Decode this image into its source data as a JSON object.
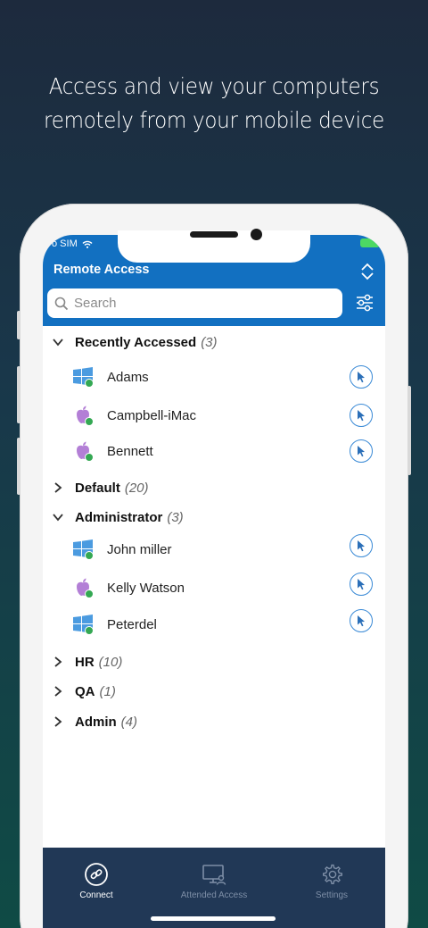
{
  "headline": {
    "line1": "Access and view your computers",
    "line2": "remotely from your mobile device"
  },
  "status_bar": {
    "carrier": "o SIM"
  },
  "app": {
    "title": "Remote Access",
    "search_placeholder": "Search"
  },
  "groups": [
    {
      "name": "Recently Accessed",
      "count": "(3)",
      "expanded": true,
      "computers": [
        {
          "name": "Adams",
          "os": "windows-icon",
          "online": true
        },
        {
          "name": "Campbell-iMac",
          "os": "apple-icon",
          "online": true
        },
        {
          "name": "Bennett",
          "os": "apple-icon",
          "online": true
        }
      ]
    },
    {
      "name": "Default",
      "count": "(20)",
      "expanded": false
    },
    {
      "name": "Administrator",
      "count": "(3)",
      "expanded": true,
      "computers": [
        {
          "name": "John miller",
          "os": "windows-icon",
          "online": true
        },
        {
          "name": "Kelly Watson",
          "os": "apple-icon",
          "online": true
        },
        {
          "name": "Peterdel",
          "os": "windows-icon",
          "online": true
        }
      ]
    },
    {
      "name": "HR",
      "count": "(10)",
      "expanded": false
    },
    {
      "name": "QA",
      "count": "(1)",
      "expanded": false
    },
    {
      "name": "Admin",
      "count": "(4)",
      "expanded": false
    }
  ],
  "tabs": [
    {
      "label": "Connect",
      "icon": "link-icon",
      "active": true
    },
    {
      "label": "Attended Access",
      "icon": "monitor-user-icon",
      "active": false
    },
    {
      "label": "Settings",
      "icon": "gear-icon",
      "active": false
    }
  ],
  "colors": {
    "header_blue": "#1270c1",
    "tabbar_navy": "#213856",
    "online_green": "#34a853",
    "windows_blue": "#4b9be0",
    "apple_purple": "#b37fd6"
  }
}
